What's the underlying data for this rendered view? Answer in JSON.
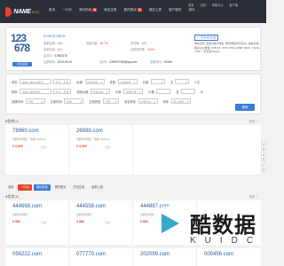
{
  "header": {
    "logo_text": "NAME",
    "logo_sub": "SHS",
    "nav": [
      {
        "label": "首页"
      },
      {
        "label": "一口价"
      },
      {
        "label": "竞价拍卖",
        "badge": "热"
      },
      {
        "label": "域名交易"
      },
      {
        "label": "委托购买",
        "badge": "热"
      },
      {
        "label": "域名工具"
      },
      {
        "label": "客户服务"
      },
      {
        "label": "资讯"
      }
    ],
    "util": [
      "登录",
      "注册",
      "帮助中心",
      "客户端"
    ]
  },
  "seller": {
    "avatar_line1": "123",
    "avatar_line2": "678",
    "follow_label": "关注店铺",
    "shop_name": "67867878878",
    "stats": [
      {
        "label": "卖家信用:",
        "value": "104",
        "tone": "red"
      },
      {
        "label": "信用分数:",
        "value": "96.7%",
        "tone": "red"
      },
      {
        "label": "好评率:",
        "value": "100",
        "tone": "red"
      },
      {
        "label": "买家信用:",
        "value": "104",
        "tone": "red"
      },
      {
        "label": "买家好评率:",
        "value": "100%",
        "tone": "red"
      },
      {
        "label": "会员ID:",
        "value": "67867878",
        "tone": "dark"
      },
      {
        "label": "注册时间:",
        "value": "2015-06-24",
        "tone": "dark"
      },
      {
        "label": "QQ号:",
        "value": "1285907056@qq.com",
        "tone": "dark"
      },
      {
        "label": "店铺访问:",
        "value": "23466",
        "tone": "dark"
      }
    ],
    "cert_label": "已实名认证",
    "about": "域名出售 [优质] 数字域名, 所有域名均可议价, 诚信交易, 联系QQ/微信: 678678, 7878, 5656, 8888, 6666, YQ231, 7788 一手货源 Skype"
  },
  "filters": {
    "row1": [
      {
        "label": "域名:",
        "value": "请输入域名关键字"
      },
      {
        "label": "",
        "value": "开头…匹配"
      },
      {
        "label": "后缀:",
        "value": "所有后缀",
        "select": true
      },
      {
        "label": "类型:",
        "value": "全部类型",
        "select": true
      },
      {
        "label": "长度:",
        "value": "",
        "select": true
      },
      {
        "label": "至",
        "value": ""
      },
      {
        "label": "",
        "value": "1 位"
      }
    ],
    "row2": [
      {
        "label": "排除:",
        "value": "请输入排除字符"
      },
      {
        "label": "",
        "value": "开头…匹配"
      },
      {
        "label": "排除后缀:",
        "value": "所有后缀",
        "select": true
      },
      {
        "label": "分类:",
        "value": "全部分类",
        "select": true
      },
      {
        "label": "价格:",
        "value": ""
      },
      {
        "label": "至",
        "value": ""
      },
      {
        "label": "",
        "value": "元"
      }
    ],
    "row3": [
      {
        "label": "到期时间:",
        "value": "不限"
      },
      {
        "label": "注册时间:",
        "value": "不限"
      },
      {
        "label": "交易类型:",
        "value": "不限",
        "select": true
      },
      {
        "label": "域名状态:",
        "value": "全部状态",
        "select": true
      },
      {
        "label": "排序:",
        "value": "默认排序",
        "select": true
      }
    ],
    "search_label": "搜索"
  },
  "sections": {
    "s1_title_prefix": "5位字",
    "s1_count": "(2)",
    "s1_more": "更多 >",
    "s2_title_prefix": "4位字",
    "s2_count": "(8)",
    "s2_more": "更多 >"
  },
  "row1": [
    {
      "name": "78960.com",
      "meta": "注册商:阿里云 · 到期: 2026-03",
      "price": "¥ 2,800",
      "tag": "一口价"
    },
    {
      "name": "26998.com",
      "meta": "注册商:阿里云 · 到期: 2025-11",
      "price": "¥ 3,500",
      "tag": "一口价"
    }
  ],
  "tabs": [
    "全部",
    "一口价",
    "竞价拍卖",
    "委托购买",
    "打包交易",
    "最新上架"
  ],
  "row2": [
    {
      "name": "444668.com",
      "meta": "注册商:阿里云",
      "price": "¥ 980",
      "tag": "一口价"
    },
    {
      "name": "444558.com",
      "meta": "注册商:阿里云",
      "price": "¥ 880",
      "tag": "一口价"
    },
    {
      "name": "444887.com",
      "meta": "注册商:阿里云",
      "price": "¥ 860",
      "tag": "一口价"
    },
    {
      "name": "",
      "meta": "",
      "price": "",
      "tag": ""
    }
  ],
  "row3": [
    {
      "name": "056222.com"
    },
    {
      "name": "077770.com"
    },
    {
      "name": "202099.com"
    },
    {
      "name": "000456.com"
    }
  ],
  "watermark": {
    "text": "酷数据",
    "sub": "KUIDC"
  },
  "side": [
    "顶部",
    "客服",
    "反馈"
  ]
}
